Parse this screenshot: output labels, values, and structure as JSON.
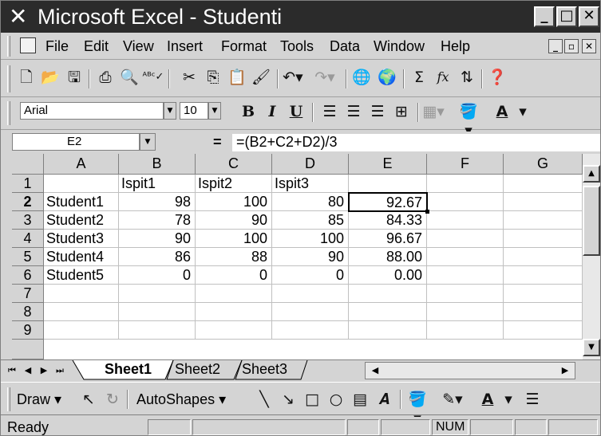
{
  "titlebar": {
    "icon": "excel-x-icon",
    "title": "Microsoft Excel - Studenti",
    "minimize": "minimize-icon",
    "maximize": "maximize-icon",
    "close": "close-icon"
  },
  "menubar": {
    "items": [
      "File",
      "Edit",
      "View",
      "Insert",
      "Format",
      "Tools",
      "Data",
      "Window",
      "Help"
    ]
  },
  "toolbar": {
    "icons": [
      "new-icon",
      "open-icon",
      "save-icon",
      "print-icon",
      "print-preview-icon",
      "spelling-icon",
      "cut-icon",
      "copy-icon",
      "paste-icon",
      "format-painter-icon",
      "undo-icon",
      "redo-icon",
      "hyperlink-icon",
      "web-toolbar-icon",
      "autosum-icon",
      "function-icon",
      "sort-ascending-icon",
      "help-icon"
    ],
    "autosum_glyph": "Σ",
    "function_glyph": "fx"
  },
  "format_toolbar": {
    "font": "Arial",
    "size": "10",
    "bold": "B",
    "italic": "I",
    "underline": "U",
    "font_color_label": "A"
  },
  "formula_bar": {
    "name_box": "E2",
    "equals": "=",
    "formula": "=(B2+C2+D2)/3"
  },
  "sheet": {
    "columns": [
      "A",
      "B",
      "C",
      "D",
      "E",
      "F",
      "G"
    ],
    "rows": [
      "1",
      "2",
      "3",
      "4",
      "5",
      "6",
      "7",
      "8",
      "9"
    ],
    "header_row": [
      "",
      "Ispit1",
      "Ispit2",
      "Ispit3",
      "",
      "",
      ""
    ],
    "data": [
      [
        "Student1",
        "98",
        "100",
        "80",
        "92.67"
      ],
      [
        "Student2",
        "78",
        "90",
        "85",
        "84.33"
      ],
      [
        "Student3",
        "90",
        "100",
        "100",
        "96.67"
      ],
      [
        "Student4",
        "86",
        "88",
        "90",
        "88.00"
      ],
      [
        "Student5",
        "0",
        "0",
        "0",
        "0.00"
      ]
    ],
    "active_cell": "E2"
  },
  "tabs": {
    "items": [
      "Sheet1",
      "Sheet2",
      "Sheet3"
    ],
    "active": "Sheet1"
  },
  "drawbar": {
    "draw": "Draw",
    "autoshapes": "AutoShapes",
    "font_color_label": "A"
  },
  "statusbar": {
    "status": "Ready",
    "num": "NUM"
  }
}
